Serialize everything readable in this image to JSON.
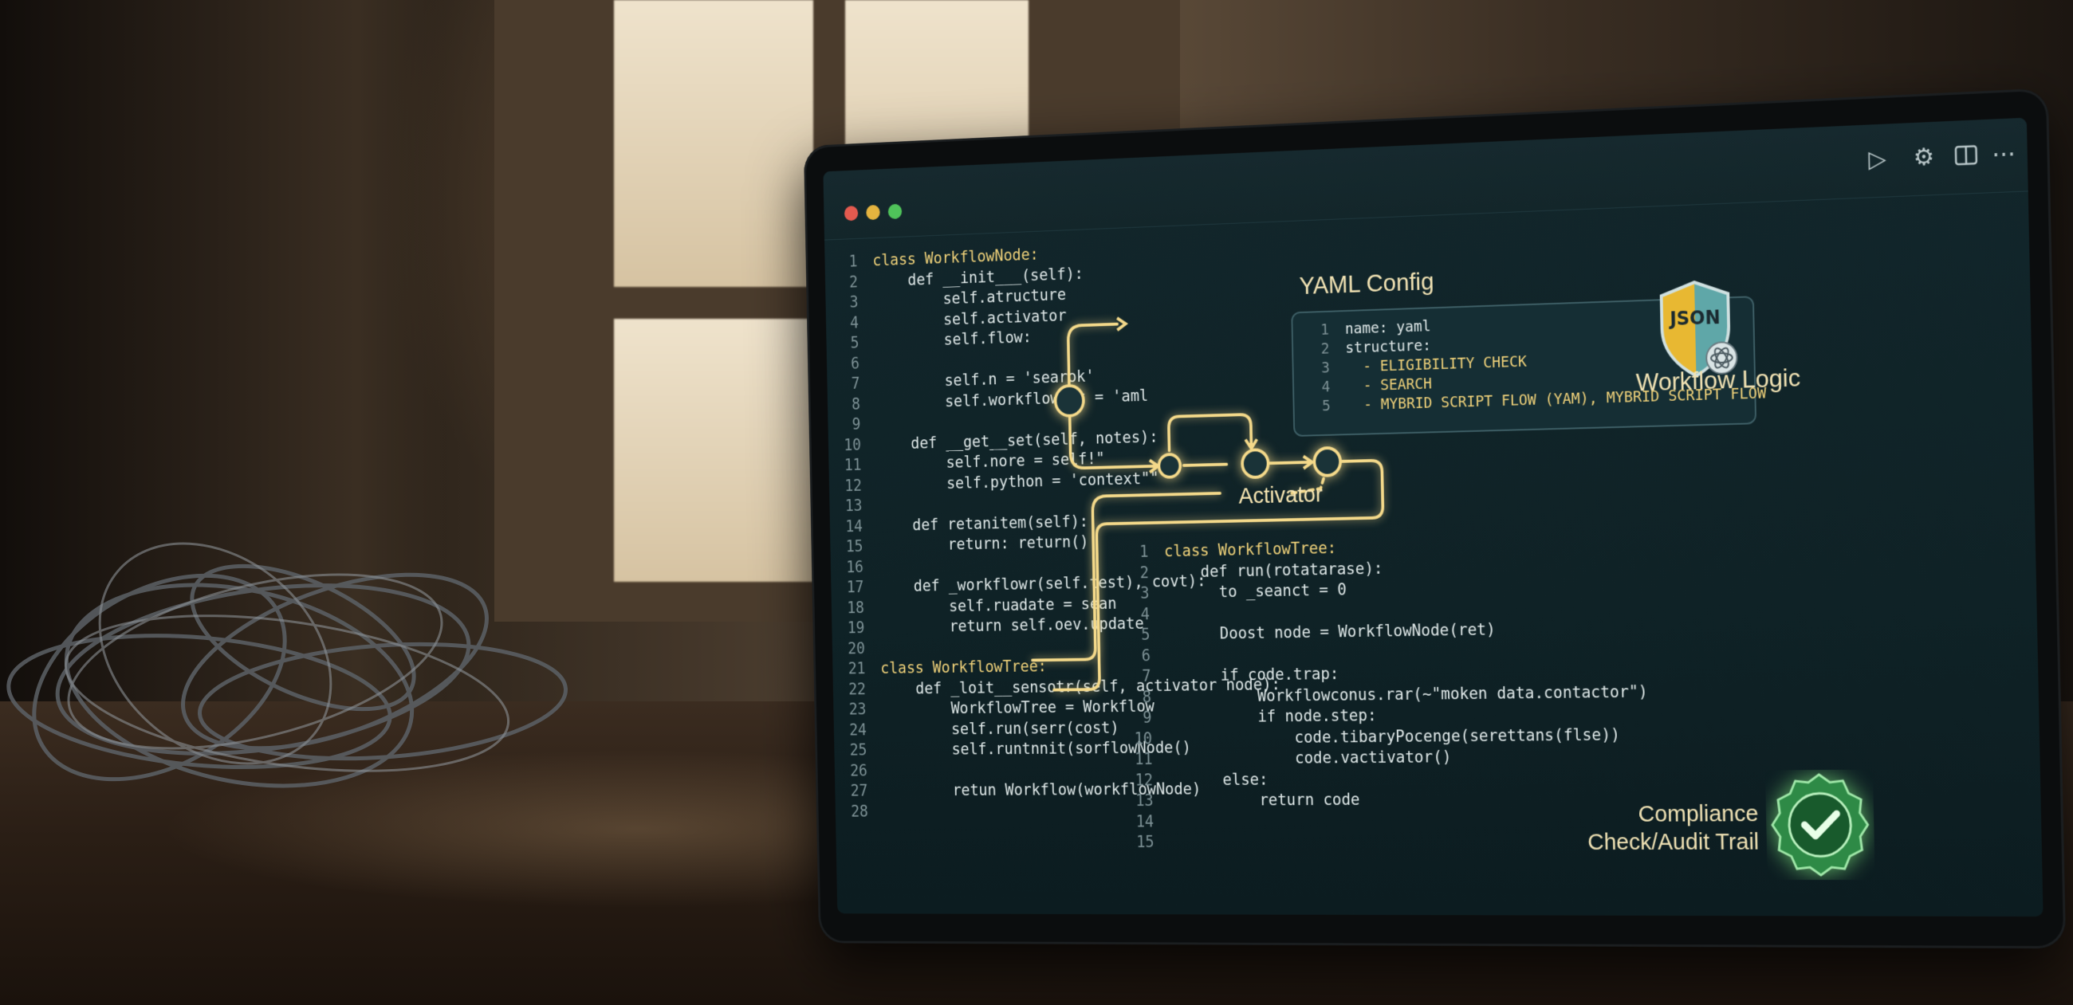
{
  "titlebar": {
    "icons": [
      "play-icon",
      "gear-icon",
      "split-panel-icon",
      "more-icon"
    ]
  },
  "left_code": [
    {
      "n": "1",
      "t": "class WorkflowNode:"
    },
    {
      "n": "2",
      "t": "    def __init___(self):"
    },
    {
      "n": "3",
      "t": "        self.atructure"
    },
    {
      "n": "4",
      "t": "        self.activator"
    },
    {
      "n": "5",
      "t": "        self.flow:"
    },
    {
      "n": "6",
      "t": ""
    },
    {
      "n": "7",
      "t": "        self.n = 'searok'"
    },
    {
      "n": "8",
      "t": "        self.workflowNat = 'aml"
    },
    {
      "n": "9",
      "t": ""
    },
    {
      "n": "10",
      "t": "    def __get__set(self, notes):"
    },
    {
      "n": "11",
      "t": "        self.nore = self!\""
    },
    {
      "n": "12",
      "t": "        self.python = 'context\"\""
    },
    {
      "n": "13",
      "t": ""
    },
    {
      "n": "14",
      "t": "    def retanitem(self):"
    },
    {
      "n": "15",
      "t": "        return: return()"
    },
    {
      "n": "16",
      "t": ""
    },
    {
      "n": "17",
      "t": "    def _workflowr(self.test), covt):"
    },
    {
      "n": "18",
      "t": "        self.ruadate = sean"
    },
    {
      "n": "19",
      "t": "        return self.oev.update"
    },
    {
      "n": "20",
      "t": ""
    },
    {
      "n": "21",
      "t": "class WorkflowTree:"
    },
    {
      "n": "22",
      "t": "    def _loit__sensotr(self, activator node):"
    },
    {
      "n": "23",
      "t": "        WorkflowTree = Workflow"
    },
    {
      "n": "24",
      "t": "        self.run(serr(cost)"
    },
    {
      "n": "25",
      "t": "        self.runtnnit(sorflowNode()"
    },
    {
      "n": "26",
      "t": ""
    },
    {
      "n": "27",
      "t": "        retun Workflow(workflowNode)"
    },
    {
      "n": "28",
      "t": ""
    }
  ],
  "yaml": {
    "label": "YAML Config",
    "lines": [
      {
        "n": "1",
        "t": "name: yaml"
      },
      {
        "n": "2",
        "t": "structure:"
      },
      {
        "n": "3",
        "t": "  - ELIGIBILITY CHECK"
      },
      {
        "n": "4",
        "t": "  - SEARCH"
      },
      {
        "n": "5",
        "t": "  - MYBRID SCRIPT FLOW (YAM), MYBRID SCRIPT FLOW"
      }
    ]
  },
  "json_badge": "JSON",
  "workflow_logic_label": "Workflow Logic",
  "activator_label": "Activator",
  "right_code": [
    {
      "n": "1",
      "t": "class WorkflowTree:"
    },
    {
      "n": "2",
      "t": "    def run(rotatarase):"
    },
    {
      "n": "3",
      "t": "      to _seanct = 0"
    },
    {
      "n": "4",
      "t": ""
    },
    {
      "n": "5",
      "t": "      Doost node = WorkflowNode(ret)"
    },
    {
      "n": "6",
      "t": ""
    },
    {
      "n": "7",
      "t": "      if code.trap:"
    },
    {
      "n": "8",
      "t": "          Workflowconus.rar(~\"moken data.contactor\")"
    },
    {
      "n": "9",
      "t": "          if node.step:"
    },
    {
      "n": "10",
      "t": "              code.tibaryPocenge(serettans(flse))"
    },
    {
      "n": "11",
      "t": "              code.vactivator()"
    },
    {
      "n": "12",
      "t": "      else:"
    },
    {
      "n": "13",
      "t": "          return code"
    },
    {
      "n": "14",
      "t": ""
    },
    {
      "n": "15",
      "t": ""
    }
  ],
  "compliance": {
    "line1": "Compliance",
    "line2": "Check/Audit Trail"
  },
  "colors": {
    "flow_line": "#f4d98a",
    "screen_bg": "#0f2226",
    "accent_text": "#f2e3b4"
  }
}
